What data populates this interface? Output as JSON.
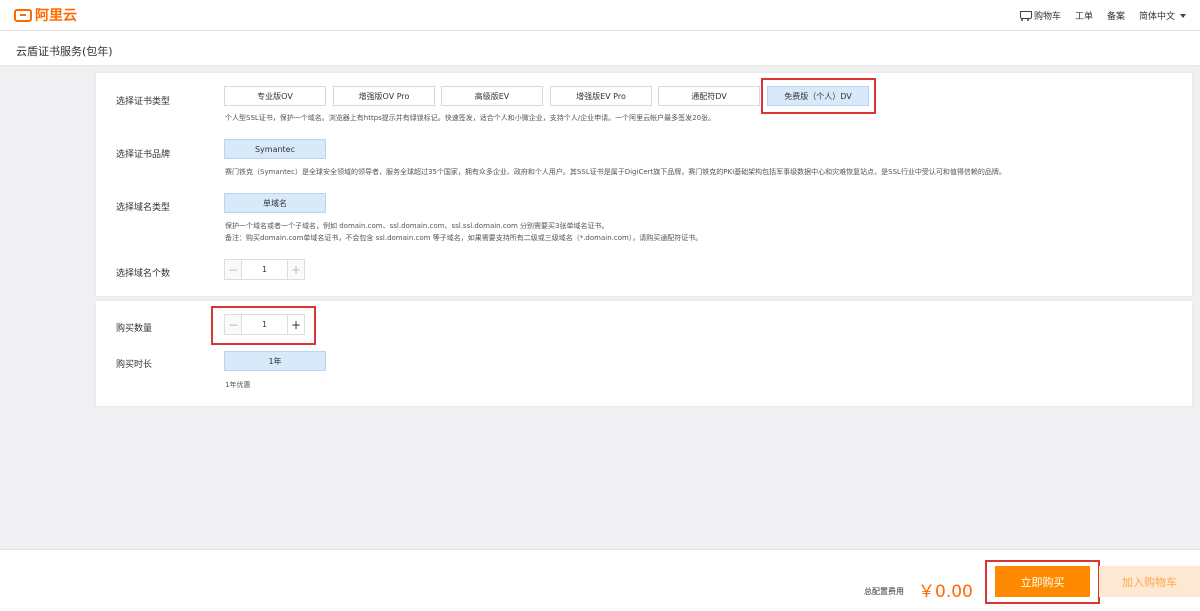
{
  "logo": {
    "text": "阿里云"
  },
  "topnav": {
    "cart": "购物车",
    "ticket": "工单",
    "filing": "备案",
    "language": "简体中文"
  },
  "page": {
    "title": "云盾证书服务(包年)"
  },
  "cert_type": {
    "label": "选择证书类型",
    "options": [
      "专业版OV",
      "增强版OV Pro",
      "高级版EV",
      "增强版EV Pro",
      "通配符DV",
      "免费版（个人）DV"
    ],
    "selected_index": 5,
    "description": "个人型SSL证书，保护一个域名。浏览器上有https提示并有绿锁标记。快速签发，适合个人和小微企业，支持个人/企业申请。一个阿里云帐户最多签发20张。"
  },
  "brand": {
    "label": "选择证书品牌",
    "option": "Symantec",
    "description": "赛门铁克（Symantec）是全球安全领域的领导者，服务全球超过35个国家，拥有众多企业、政府和个人用户。其SSL证书是属于DigiCert旗下品牌，赛门铁克的PKI基础架构包括军事级数据中心和灾难恢复站点，是SSL行业中受认可和值得信赖的品牌。"
  },
  "domain_type": {
    "label": "选择域名类型",
    "option": "单域名",
    "description_line1": "保护一个域名或者一个子域名，例如 domain.com、ssl.domain.com、ssl.ssl.domain.com 分别需要买3张单域名证书。",
    "description_line2": "备注：购买domain.com单域名证书，不会包含 ssl.domain.com 等子域名，如果需要支持所有二级或三级域名（*.domain.com），请购买通配符证书。"
  },
  "domain_count": {
    "label": "选择域名个数",
    "value": "1",
    "minus": "−",
    "plus": "+"
  },
  "quantity": {
    "label": "购买数量",
    "value": "1",
    "minus": "−",
    "plus": "+"
  },
  "duration": {
    "label": "购买时长",
    "option": "1年",
    "note": "1年优惠"
  },
  "footer": {
    "total_label": "总配置费用",
    "total_value": "￥0.00",
    "buy_now": "立即购买",
    "add_to_cart": "加入购物车"
  },
  "colors": {
    "brand": "#ff6a00",
    "highlight": "#d93636",
    "selected_bg": "#d8eaf9",
    "buy_button": "#ff8a00"
  }
}
